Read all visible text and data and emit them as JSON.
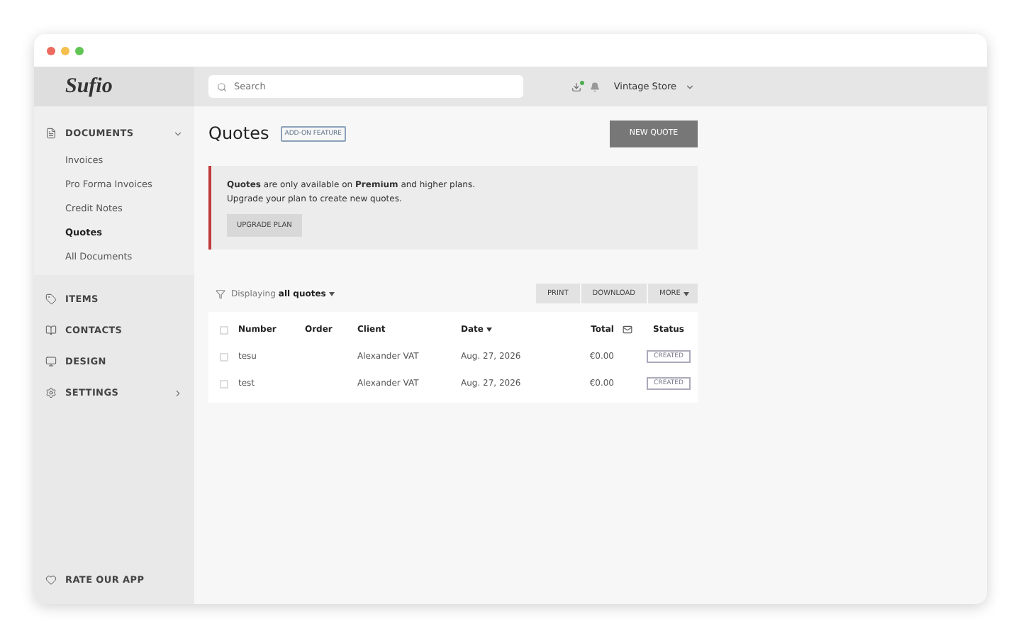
{
  "logo": "Sufio",
  "search": {
    "placeholder": "Search"
  },
  "topbar": {
    "download_badge": true,
    "store": "Vintage Store"
  },
  "sidebar": {
    "sections": [
      {
        "kind": "documents",
        "label": "DOCUMENTS",
        "expanded": true,
        "children": [
          {
            "label": "Invoices",
            "selected": false
          },
          {
            "label": "Pro Forma Invoices",
            "selected": false
          },
          {
            "label": "Credit Notes",
            "selected": false
          },
          {
            "label": "Quotes",
            "selected": true
          },
          {
            "label": "All Documents",
            "selected": false
          }
        ]
      },
      {
        "kind": "items",
        "label": "ITEMS"
      },
      {
        "kind": "contacts",
        "label": "CONTACTS"
      },
      {
        "kind": "design",
        "label": "DESIGN"
      },
      {
        "kind": "settings",
        "label": "SETTINGS",
        "expanded": false
      }
    ],
    "footer": "RATE OUR APP"
  },
  "page": {
    "title": "Quotes",
    "badge": "ADD-ON FEATURE",
    "new_button": "NEW QUOTE"
  },
  "banner": {
    "lines": [
      "**Quotes** are only available on **Premium** and higher plans.",
      "Upgrade your plan to create new quotes."
    ],
    "button": "UPGRADE PLAN"
  },
  "filter": {
    "prefix": "Displaying",
    "value": "all quotes"
  },
  "actions": [
    "PRINT",
    "DOWNLOAD",
    "MORE"
  ],
  "table": {
    "select_all_checked": false,
    "columns": [
      "Number",
      "Order",
      "Client",
      "Date",
      "Total",
      "Status"
    ],
    "rows": [
      {
        "number": "tesu",
        "order": "",
        "client": "Alexander VAT",
        "date": "Aug. 27, 2026",
        "total": "€0.00",
        "status": "CREATED",
        "checked": false
      },
      {
        "number": "test",
        "order": "",
        "client": "Alexander VAT",
        "date": "Aug. 27, 2026",
        "total": "€0.00",
        "status": "CREATED",
        "checked": false
      }
    ]
  }
}
